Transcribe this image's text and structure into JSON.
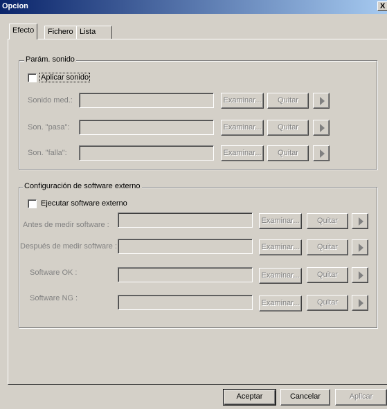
{
  "window": {
    "title": "Opcion",
    "close_glyph": "X"
  },
  "tabs": [
    {
      "label": "Efecto",
      "active": true
    },
    {
      "label": "Fichero",
      "active": false
    },
    {
      "label": "Lista",
      "active": false
    }
  ],
  "sound_group": {
    "legend": "Parám. sonido",
    "apply_label": "Aplicar sonido",
    "apply_checked": false,
    "rows": [
      {
        "label": "Sonido med.:",
        "value": "",
        "browse": "Examinar...",
        "remove": "Quitar"
      },
      {
        "label": "Son. \"pasa\":",
        "value": "",
        "browse": "Examinar...",
        "remove": "Quitar"
      },
      {
        "label": "Son. \"falla\":",
        "value": "",
        "browse": "Examinar...",
        "remove": "Quitar"
      }
    ]
  },
  "software_group": {
    "legend": "Configuración de software externo",
    "run_label": "Ejecutar software externo",
    "run_checked": false,
    "rows": [
      {
        "label": "Antes de medir software :",
        "value": "",
        "browse": "Examinar...",
        "remove": "Quitar"
      },
      {
        "label": "Después de medir software :",
        "value": "",
        "browse": "Examinar...",
        "remove": "Quitar"
      },
      {
        "label": "Software OK :",
        "value": "",
        "browse": "Examinar...",
        "remove": "Quitar"
      },
      {
        "label": "Software NG :",
        "value": "",
        "browse": "Examinar...",
        "remove": "Quitar"
      }
    ]
  },
  "footer": {
    "accept": "Aceptar",
    "cancel": "Cancelar",
    "apply": "Aplicar"
  },
  "icons": {
    "play": "play-icon",
    "close": "close-icon"
  },
  "colors": {
    "face": "#d4d0c8",
    "title_start": "#0a246a",
    "title_end": "#a6caf0",
    "disabled_text": "#808080"
  }
}
